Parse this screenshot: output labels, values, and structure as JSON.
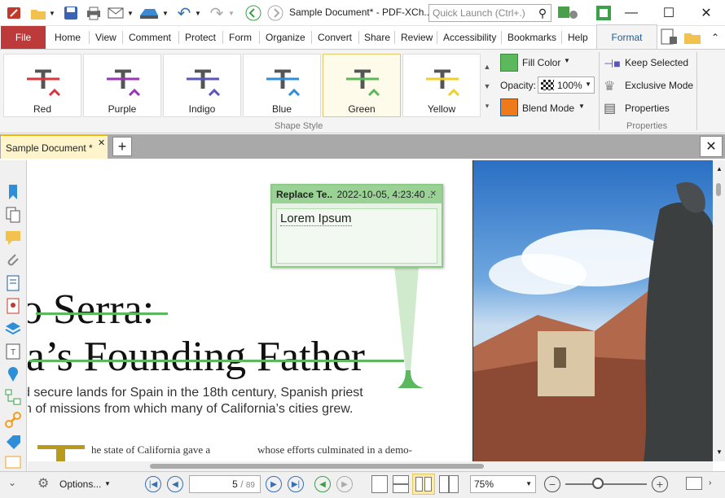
{
  "window": {
    "title": "Sample Document* - PDF-XCh..",
    "quick_launch_placeholder": "Quick Launch (Ctrl+.)"
  },
  "menu": {
    "file": "File",
    "items": [
      "Home",
      "View",
      "Comment",
      "Protect",
      "Form",
      "Organize",
      "Convert",
      "Share",
      "Review",
      "Accessibility",
      "Bookmarks",
      "Help"
    ],
    "format": "Format"
  },
  "ribbon": {
    "shape_styles": [
      {
        "label": "Red",
        "color": "#d9363e"
      },
      {
        "label": "Purple",
        "color": "#9b35b5"
      },
      {
        "label": "Indigo",
        "color": "#5a55b8"
      },
      {
        "label": "Blue",
        "color": "#2e8fd8"
      },
      {
        "label": "Green",
        "color": "#5cb85c",
        "selected": true
      },
      {
        "label": "Yellow",
        "color": "#f0cf2a"
      }
    ],
    "shape_style_group": "Shape Style",
    "fill_color": "Fill Color",
    "fill_swatch": "#5cb85c",
    "opacity_label": "Opacity:",
    "opacity_value": "100%",
    "blend_mode": "Blend Mode",
    "keep_selected": "Keep Selected",
    "exclusive_mode": "Exclusive Mode",
    "properties": "Properties",
    "properties_group": "Properties"
  },
  "tab": {
    "label": "Sample Document *"
  },
  "document": {
    "title_line1": "o Serra:",
    "title_line2": "a’s Founding Father",
    "body_line1": "d secure lands for Spain in the 18th century, Spanish priest",
    "body_line2": "n of missions from which many of California’s cities grew.",
    "col1_text": "he state of California gave a",
    "col2_text": "whose efforts culminated in a demo-",
    "drop_cap": "T"
  },
  "note": {
    "header_title": "Replace Te..",
    "header_date": "2022-10-05, 4:23:40 ..",
    "body": "Lorem Ipsum"
  },
  "status": {
    "options": "Options...",
    "current_page": "5",
    "total_pages": "89",
    "zoom": "75%"
  }
}
